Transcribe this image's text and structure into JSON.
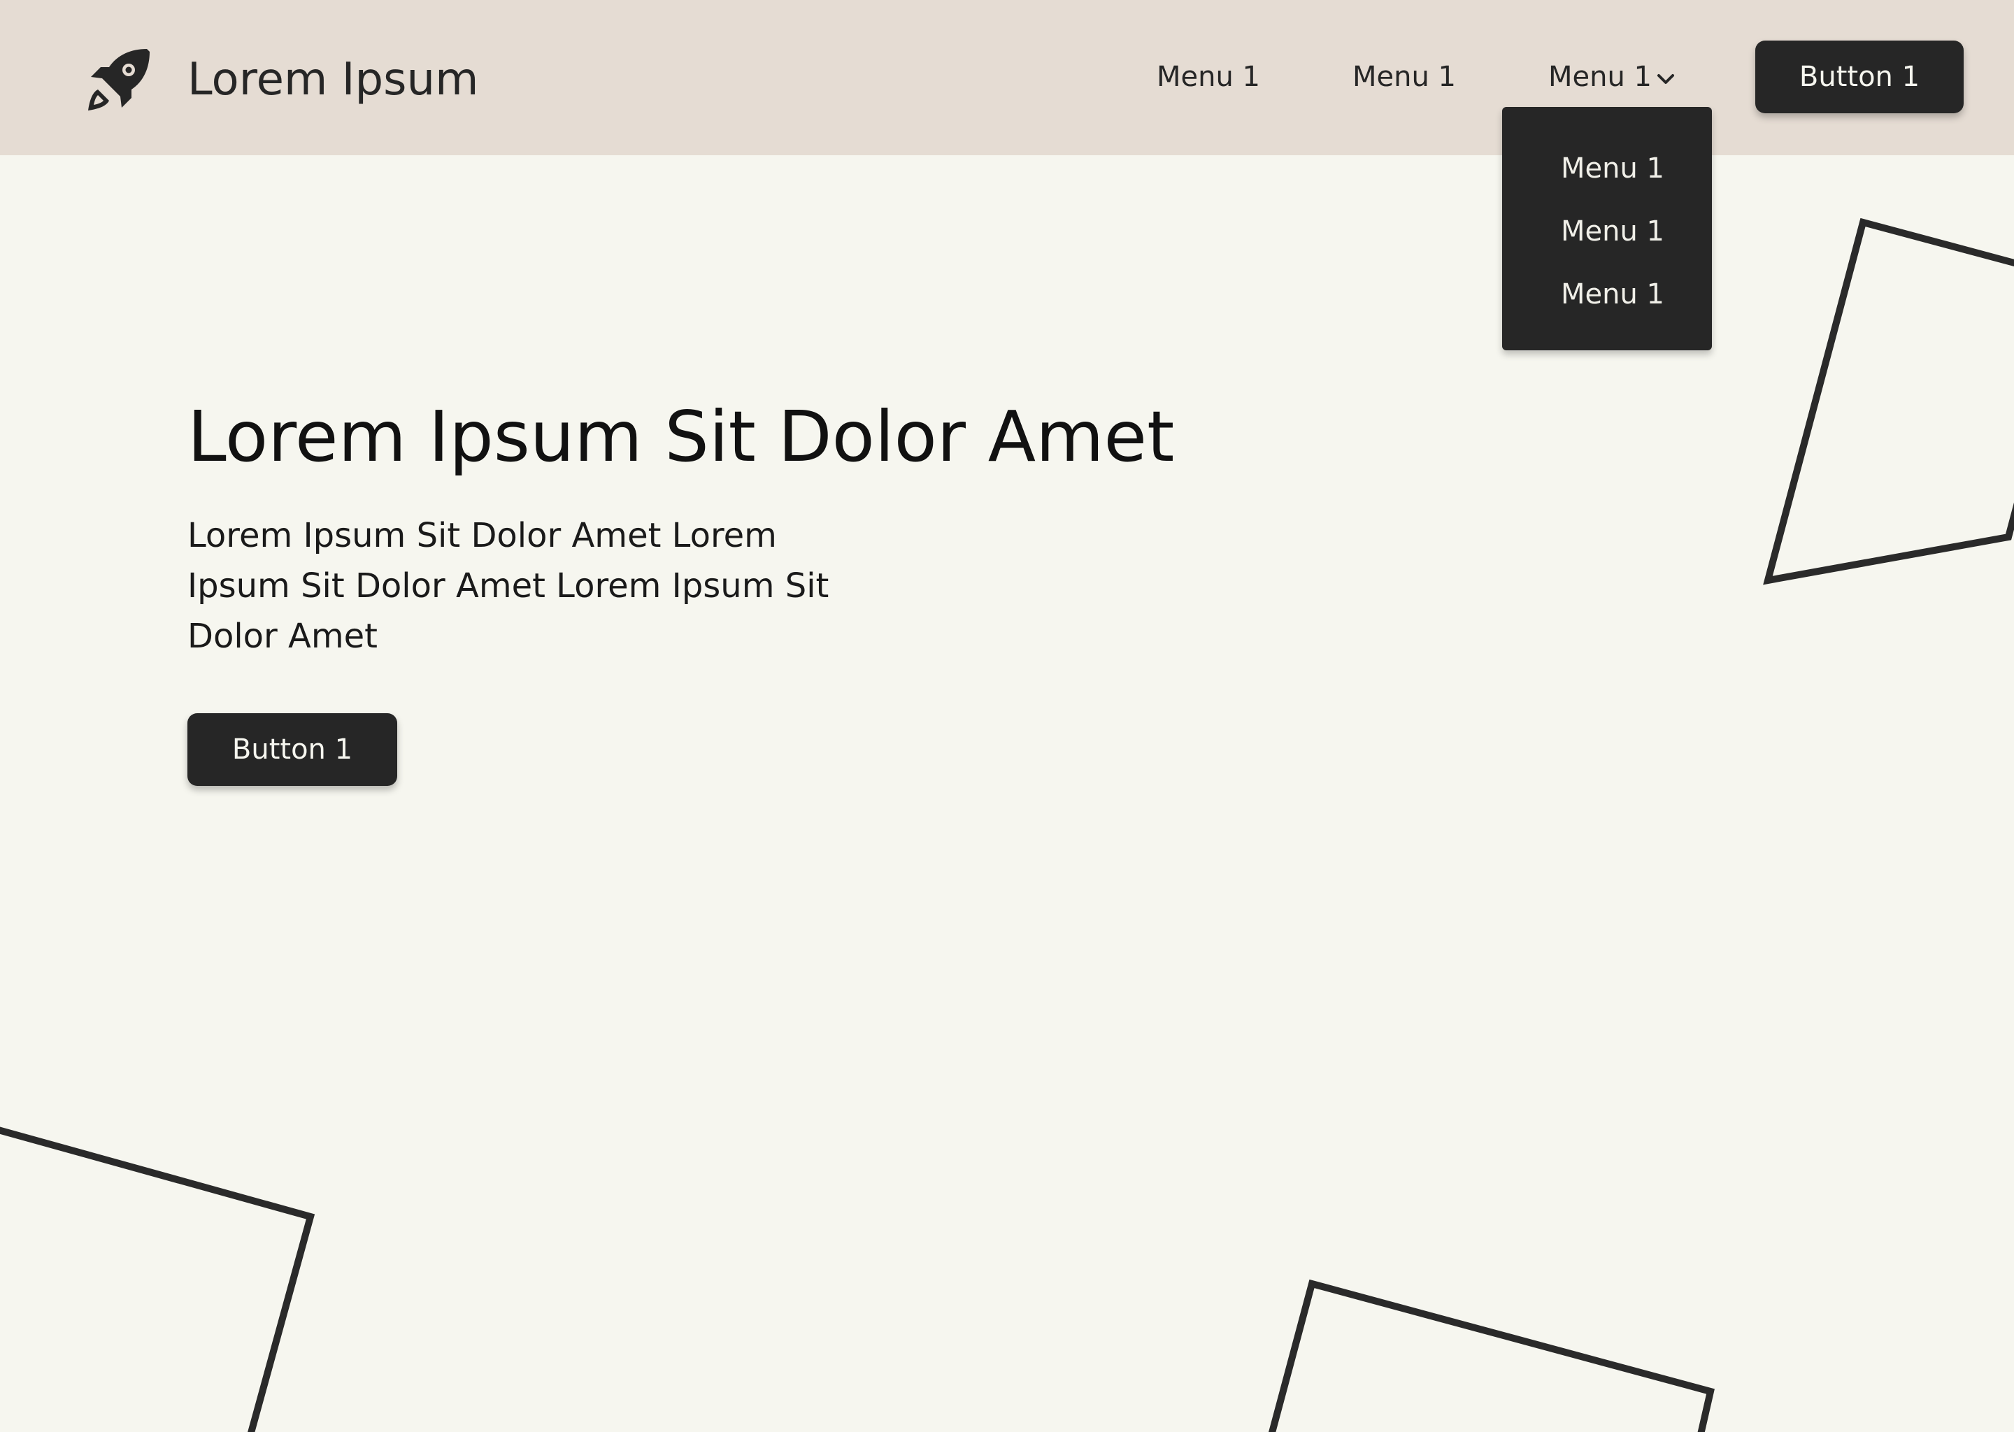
{
  "header": {
    "brand": "Lorem Ipsum",
    "logo_icon": "rocket-icon",
    "nav": [
      {
        "label": "Menu 1"
      },
      {
        "label": "Menu 1"
      },
      {
        "label": "Menu 1",
        "icon": "chevron-down-icon"
      }
    ],
    "button_label": "Button 1"
  },
  "dropdown": {
    "items": [
      {
        "label": "Menu 1"
      },
      {
        "label": "Menu 1"
      },
      {
        "label": "Menu 1"
      }
    ]
  },
  "hero": {
    "title": "Lorem Ipsum Sit Dolor Amet",
    "body": "Lorem Ipsum Sit Dolor Amet Lorem Ipsum Sit Dolor Amet Lorem Ipsum Sit Dolor Amet",
    "button_label": "Button 1"
  },
  "colors": {
    "header_bg": "#e5dcd3",
    "page_bg": "#f6f6ef",
    "dark": "#262626"
  }
}
